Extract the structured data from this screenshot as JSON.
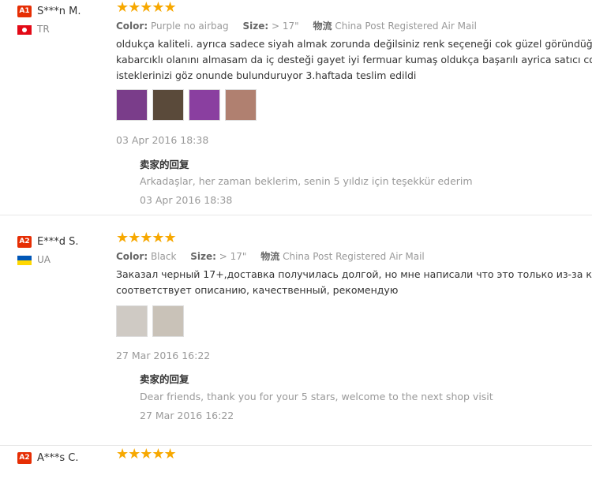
{
  "reviews": [
    {
      "badge": "A1",
      "name": "S***n M.",
      "country": "TR",
      "stars": "★★★★★",
      "color_label": "Color:",
      "color_value": "Purple no airbag",
      "size_label": "Size:",
      "size_value": "> 17\"",
      "shipping_label": "物流",
      "shipping_value": "China Post Registered Air Mail",
      "text_lines": [
        "oldukça kaliteli. ayrıca sadece siyah almak zorunda değilsiniz renk seçeneği cok güzel göründüğü gibi",
        "kabarcıklı olanını almasam da iç desteği gayet iyi fermuar kumaş oldukça başarılı ayrica satıcı cok hızlı",
        "isteklerinizi göz onunde bulunduruyor 3.haftada teslim edildi"
      ],
      "thumb_colors": [
        "#7a3d8a",
        "#5a4a3a",
        "#8a3fa0",
        "#b08070"
      ],
      "date": "03 Apr 2016 18:38",
      "reply_title": "卖家的回复",
      "reply_text": "Arkadaşlar, her zaman beklerim, senin 5 yıldız için teşekkür ederim",
      "reply_date": "03 Apr 2016 18:38"
    },
    {
      "badge": "A2",
      "name": "E***d S.",
      "country": "UA",
      "stars": "★★★★★",
      "color_label": "Color:",
      "color_value": "Black",
      "size_label": "Size:",
      "size_value": "> 17\"",
      "shipping_label": "物流",
      "shipping_value": "China Post Registered Air Mail",
      "text_lines": [
        "Заказал черный 17+,доставка получилась долгой, но мне написали что это только из-за китайского нового года,",
        "соответствует описанию, качественный, рекомендую"
      ],
      "thumb_colors": [
        "#cfcac4",
        "#c9c2b8"
      ],
      "date": "27 Mar 2016 16:22",
      "reply_title": "卖家的回复",
      "reply_text": "Dear friends, thank you for your 5 stars, welcome to the next shop visit",
      "reply_date": "27 Mar 2016 16:22"
    },
    {
      "badge": "A2",
      "name": "A***s C.",
      "stars": "★★★★★"
    }
  ]
}
